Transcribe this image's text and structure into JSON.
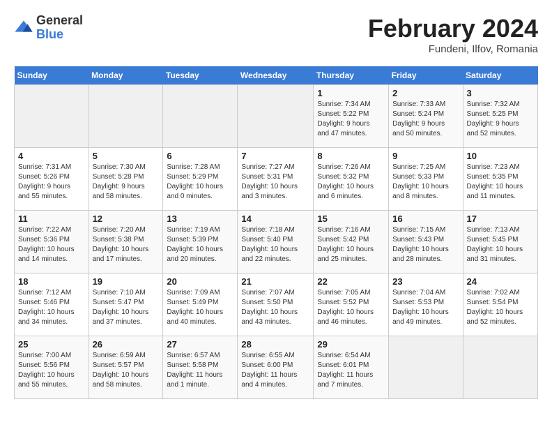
{
  "header": {
    "logo_general": "General",
    "logo_blue": "Blue",
    "month_title": "February 2024",
    "location": "Fundeni, Ilfov, Romania"
  },
  "calendar": {
    "days_of_week": [
      "Sunday",
      "Monday",
      "Tuesday",
      "Wednesday",
      "Thursday",
      "Friday",
      "Saturday"
    ],
    "weeks": [
      [
        {
          "day": "",
          "info": ""
        },
        {
          "day": "",
          "info": ""
        },
        {
          "day": "",
          "info": ""
        },
        {
          "day": "",
          "info": ""
        },
        {
          "day": "1",
          "info": "Sunrise: 7:34 AM\nSunset: 5:22 PM\nDaylight: 9 hours\nand 47 minutes."
        },
        {
          "day": "2",
          "info": "Sunrise: 7:33 AM\nSunset: 5:24 PM\nDaylight: 9 hours\nand 50 minutes."
        },
        {
          "day": "3",
          "info": "Sunrise: 7:32 AM\nSunset: 5:25 PM\nDaylight: 9 hours\nand 52 minutes."
        }
      ],
      [
        {
          "day": "4",
          "info": "Sunrise: 7:31 AM\nSunset: 5:26 PM\nDaylight: 9 hours\nand 55 minutes."
        },
        {
          "day": "5",
          "info": "Sunrise: 7:30 AM\nSunset: 5:28 PM\nDaylight: 9 hours\nand 58 minutes."
        },
        {
          "day": "6",
          "info": "Sunrise: 7:28 AM\nSunset: 5:29 PM\nDaylight: 10 hours\nand 0 minutes."
        },
        {
          "day": "7",
          "info": "Sunrise: 7:27 AM\nSunset: 5:31 PM\nDaylight: 10 hours\nand 3 minutes."
        },
        {
          "day": "8",
          "info": "Sunrise: 7:26 AM\nSunset: 5:32 PM\nDaylight: 10 hours\nand 6 minutes."
        },
        {
          "day": "9",
          "info": "Sunrise: 7:25 AM\nSunset: 5:33 PM\nDaylight: 10 hours\nand 8 minutes."
        },
        {
          "day": "10",
          "info": "Sunrise: 7:23 AM\nSunset: 5:35 PM\nDaylight: 10 hours\nand 11 minutes."
        }
      ],
      [
        {
          "day": "11",
          "info": "Sunrise: 7:22 AM\nSunset: 5:36 PM\nDaylight: 10 hours\nand 14 minutes."
        },
        {
          "day": "12",
          "info": "Sunrise: 7:20 AM\nSunset: 5:38 PM\nDaylight: 10 hours\nand 17 minutes."
        },
        {
          "day": "13",
          "info": "Sunrise: 7:19 AM\nSunset: 5:39 PM\nDaylight: 10 hours\nand 20 minutes."
        },
        {
          "day": "14",
          "info": "Sunrise: 7:18 AM\nSunset: 5:40 PM\nDaylight: 10 hours\nand 22 minutes."
        },
        {
          "day": "15",
          "info": "Sunrise: 7:16 AM\nSunset: 5:42 PM\nDaylight: 10 hours\nand 25 minutes."
        },
        {
          "day": "16",
          "info": "Sunrise: 7:15 AM\nSunset: 5:43 PM\nDaylight: 10 hours\nand 28 minutes."
        },
        {
          "day": "17",
          "info": "Sunrise: 7:13 AM\nSunset: 5:45 PM\nDaylight: 10 hours\nand 31 minutes."
        }
      ],
      [
        {
          "day": "18",
          "info": "Sunrise: 7:12 AM\nSunset: 5:46 PM\nDaylight: 10 hours\nand 34 minutes."
        },
        {
          "day": "19",
          "info": "Sunrise: 7:10 AM\nSunset: 5:47 PM\nDaylight: 10 hours\nand 37 minutes."
        },
        {
          "day": "20",
          "info": "Sunrise: 7:09 AM\nSunset: 5:49 PM\nDaylight: 10 hours\nand 40 minutes."
        },
        {
          "day": "21",
          "info": "Sunrise: 7:07 AM\nSunset: 5:50 PM\nDaylight: 10 hours\nand 43 minutes."
        },
        {
          "day": "22",
          "info": "Sunrise: 7:05 AM\nSunset: 5:52 PM\nDaylight: 10 hours\nand 46 minutes."
        },
        {
          "day": "23",
          "info": "Sunrise: 7:04 AM\nSunset: 5:53 PM\nDaylight: 10 hours\nand 49 minutes."
        },
        {
          "day": "24",
          "info": "Sunrise: 7:02 AM\nSunset: 5:54 PM\nDaylight: 10 hours\nand 52 minutes."
        }
      ],
      [
        {
          "day": "25",
          "info": "Sunrise: 7:00 AM\nSunset: 5:56 PM\nDaylight: 10 hours\nand 55 minutes."
        },
        {
          "day": "26",
          "info": "Sunrise: 6:59 AM\nSunset: 5:57 PM\nDaylight: 10 hours\nand 58 minutes."
        },
        {
          "day": "27",
          "info": "Sunrise: 6:57 AM\nSunset: 5:58 PM\nDaylight: 11 hours\nand 1 minute."
        },
        {
          "day": "28",
          "info": "Sunrise: 6:55 AM\nSunset: 6:00 PM\nDaylight: 11 hours\nand 4 minutes."
        },
        {
          "day": "29",
          "info": "Sunrise: 6:54 AM\nSunset: 6:01 PM\nDaylight: 11 hours\nand 7 minutes."
        },
        {
          "day": "",
          "info": ""
        },
        {
          "day": "",
          "info": ""
        }
      ]
    ]
  }
}
